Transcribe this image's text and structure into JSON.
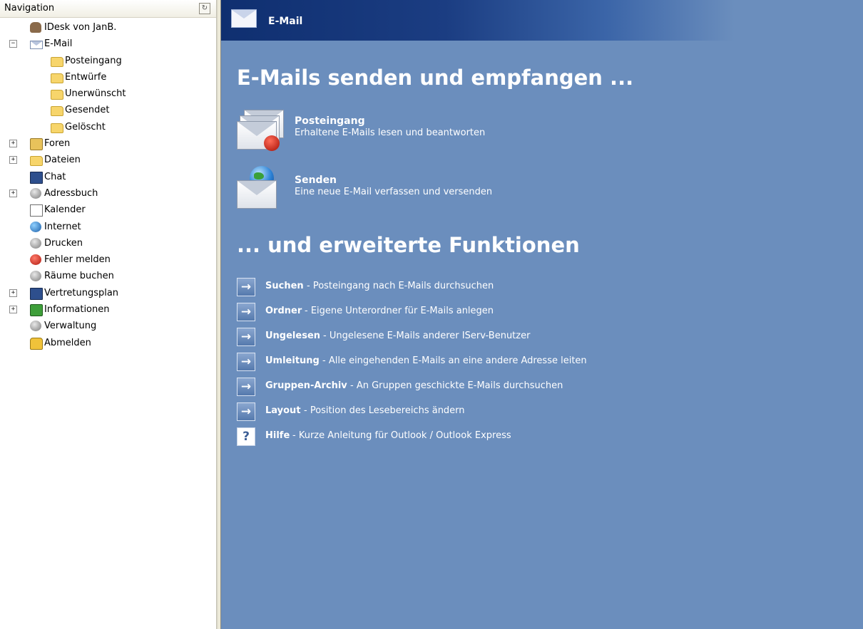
{
  "sidebar": {
    "header": "Navigation",
    "tree": [
      {
        "label": "IDesk von JanB.",
        "icon": "user-desk-icon"
      },
      {
        "label": "E-Mail",
        "icon": "mail-icon",
        "expander": "−"
      },
      {
        "label": "Posteingang",
        "icon": "inbox-folder-icon"
      },
      {
        "label": "Entwürfe",
        "icon": "folder-icon"
      },
      {
        "label": "Unerwünscht",
        "icon": "folder-icon"
      },
      {
        "label": "Gesendet",
        "icon": "folder-icon"
      },
      {
        "label": "Gelöscht",
        "icon": "folder-icon"
      },
      {
        "label": "Foren",
        "icon": "forum-icon",
        "expander": "+"
      },
      {
        "label": "Dateien",
        "icon": "files-icon",
        "expander": "+"
      },
      {
        "label": "Chat",
        "icon": "chat-icon"
      },
      {
        "label": "Adressbuch",
        "icon": "addressbook-icon",
        "expander": "+"
      },
      {
        "label": "Kalender",
        "icon": "calendar-icon"
      },
      {
        "label": "Internet",
        "icon": "globe-icon"
      },
      {
        "label": "Drucken",
        "icon": "printer-icon"
      },
      {
        "label": "Fehler melden",
        "icon": "alarm-icon"
      },
      {
        "label": "Räume buchen",
        "icon": "room-booking-icon"
      },
      {
        "label": "Vertretungsplan",
        "icon": "timetable-icon",
        "expander": "+"
      },
      {
        "label": "Informationen",
        "icon": "info-board-icon",
        "expander": "+"
      },
      {
        "label": "Verwaltung",
        "icon": "gear-icon"
      },
      {
        "label": "Abmelden",
        "icon": "lock-icon"
      }
    ]
  },
  "main": {
    "titlebar": "E-Mail",
    "heading1": "E-Mails senden und empfangen ...",
    "features": [
      {
        "title": "Posteingang",
        "desc": "Erhaltene E-Mails lesen und beantworten"
      },
      {
        "title": "Senden",
        "desc": "Eine neue E-Mail verfassen und versenden"
      }
    ],
    "heading2": "... und erweiterte Funktionen",
    "links": [
      {
        "name": "Suchen",
        "desc": "- Posteingang nach E-Mails durchsuchen",
        "icon": "→"
      },
      {
        "name": "Ordner",
        "desc": "- Eigene Unterordner für E-Mails anlegen",
        "icon": "→"
      },
      {
        "name": "Ungelesen",
        "desc": "- Ungelesene E-Mails anderer IServ-Benutzer",
        "icon": "→"
      },
      {
        "name": "Umleitung",
        "desc": "- Alle eingehenden E-Mails an eine andere Adresse leiten",
        "icon": "→"
      },
      {
        "name": "Gruppen-Archiv",
        "desc": "- An Gruppen geschickte E-Mails durchsuchen",
        "icon": "→"
      },
      {
        "name": "Layout",
        "desc": "- Position des Lesebereichs ändern",
        "icon": "→"
      },
      {
        "name": "Hilfe",
        "desc": "- Kurze Anleitung für Outlook / Outlook Express",
        "icon": "?"
      }
    ]
  },
  "colors": {
    "main_bg": "#6b8ebd",
    "titlebar_dark": "#0f2f70",
    "text_on_main": "#ffffff"
  }
}
